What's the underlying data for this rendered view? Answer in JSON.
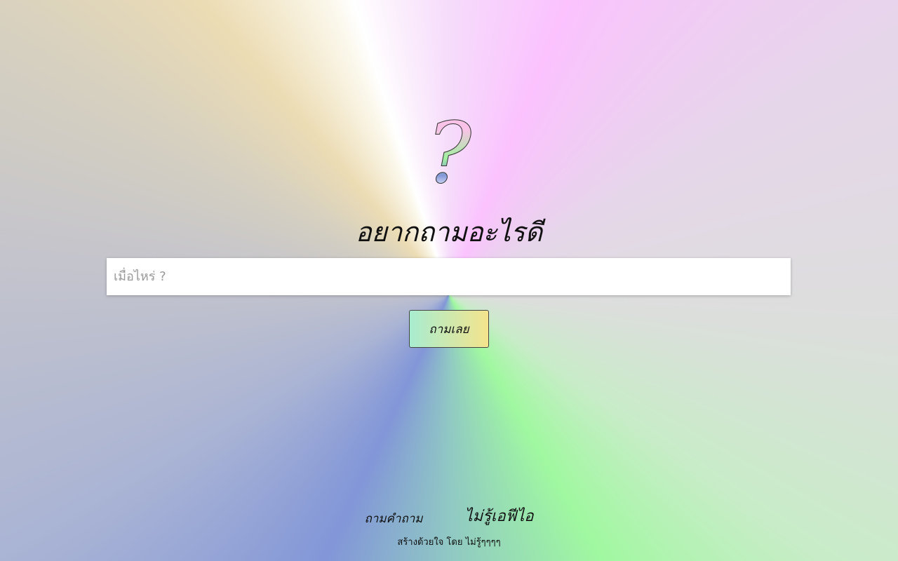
{
  "hero": {
    "icon": "question-mark-icon",
    "icon_glyph": "?",
    "title": "อยากถามอะไรดี"
  },
  "search": {
    "placeholder": "เมื่อไหร่ ?",
    "value": ""
  },
  "submit_label": "ถามเลย",
  "nav": {
    "ask_question": "ถามคำถาม",
    "dont_know_ip": "ไม่รู้เอฟีไอ"
  },
  "footer": "สร้างด้วยใจ โดย ไม่รู้ๆๆๆๆ"
}
